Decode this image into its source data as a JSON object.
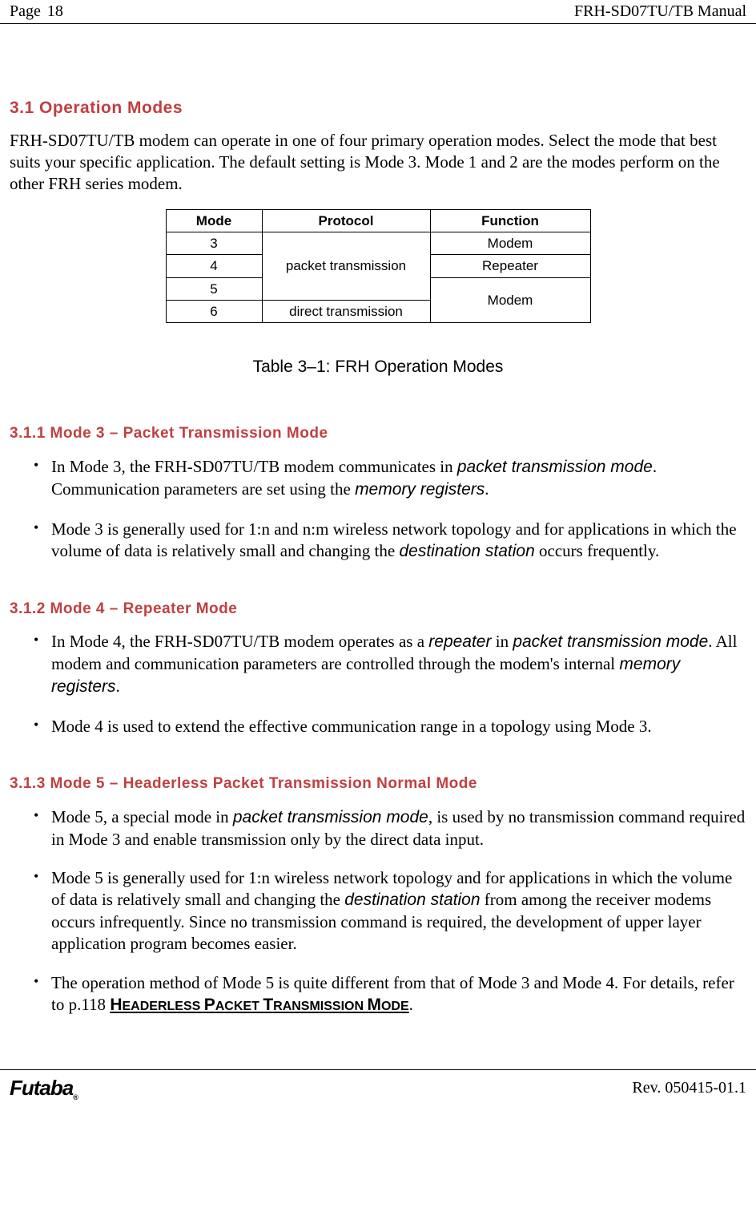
{
  "header": {
    "page_label": "Page",
    "page_number": "18",
    "manual": "FRH-SD07TU/TB Manual"
  },
  "section": {
    "heading": "3.1  Operation Modes",
    "intro": "FRH-SD07TU/TB modem can operate in one of four primary operation modes. Select the mode that best suits your specific application. The default setting is Mode 3. Mode 1 and 2 are the modes perform on the other FRH series modem."
  },
  "table": {
    "headers": {
      "mode": "Mode",
      "protocol": "Protocol",
      "function": "Function"
    },
    "rows": {
      "r1_mode": "3",
      "r2_mode": "4",
      "r3_mode": "5",
      "r4_mode": "6",
      "packet": "packet transmission",
      "direct": "direct transmission",
      "fn_modem1": "Modem",
      "fn_repeater": "Repeater",
      "fn_modem2": "Modem"
    },
    "caption": "Table 3–1:  FRH Operation Modes"
  },
  "sub1": {
    "heading": "3.1.1  Mode 3 – Packet Transmission Mode",
    "b1a": "In Mode 3, the FRH-SD07TU/TB modem communicates in ",
    "b1b": "packet transmission mode",
    "b1c": ". Communication parameters are set using the ",
    "b1d": "memory registers",
    "b1e": ".",
    "b2a": "Mode 3 is generally used for 1:n and n:m wireless network topology and for applications in which the volume of data is relatively small and changing the ",
    "b2b": "destination station",
    "b2c": " occurs frequently."
  },
  "sub2": {
    "heading": "3.1.2  Mode 4 – Repeater Mode",
    "b1a": "In Mode 4, the FRH-SD07TU/TB modem operates as a ",
    "b1b": "repeater",
    "b1c": " in ",
    "b1d": "packet transmission mode",
    "b1e": ". All modem and communication parameters are controlled through the modem's internal ",
    "b1f": "memory registers",
    "b1g": ".",
    "b2": "Mode 4 is used to extend the effective communication range in a topology using Mode 3."
  },
  "sub3": {
    "heading": "3.1.3  Mode 5 – Headerless Packet Transmission Normal Mode",
    "b1a": " Mode 5, a special mode in ",
    "b1b": "packet transmission mode",
    "b1c": ", is used by no transmission command required in Mode 3 and enable transmission only by the direct data input.",
    "b2a": " Mode 5 is generally used for 1:n wireless network topology and for applications in which the volume of data is relatively small and changing the ",
    "b2b": "destination station",
    "b2c": " from among the receiver modems occurs infrequently. Since no transmission command is required, the development of upper layer application program becomes easier.",
    "b3a": " The operation method of Mode 5 is quite different from that of Mode 3 and Mode 4. For details, refer to p.118 ",
    "b3b_h": "H",
    "b3b_rest": "EADERLESS ",
    "b3c_p": "P",
    "b3c_rest": "ACKET ",
    "b3d_t": "T",
    "b3d_rest": "RANSMISSION ",
    "b3e_m": "M",
    "b3e_rest": "ODE",
    "b3f": "."
  },
  "footer": {
    "logo": "Futaba",
    "rev": "Rev. 050415-01.1"
  }
}
